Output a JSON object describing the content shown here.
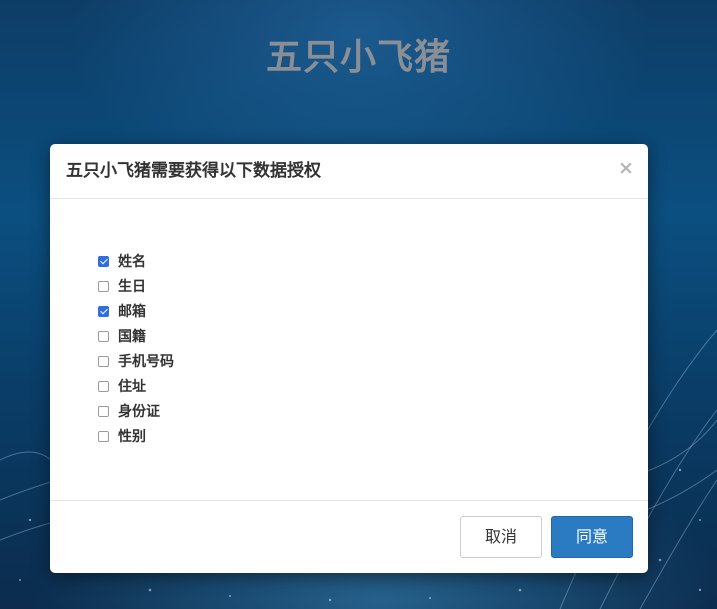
{
  "app": {
    "title": "五只小飞猪"
  },
  "dialog": {
    "title": "五只小飞猪需要获得以下数据授权",
    "close_symbol": "×",
    "permissions": [
      {
        "label": "姓名",
        "checked": true
      },
      {
        "label": "生日",
        "checked": false
      },
      {
        "label": "邮箱",
        "checked": true
      },
      {
        "label": "国籍",
        "checked": false
      },
      {
        "label": "手机号码",
        "checked": false
      },
      {
        "label": "住址",
        "checked": false
      },
      {
        "label": "身份证",
        "checked": false
      },
      {
        "label": "性别",
        "checked": false
      }
    ],
    "cancel_label": "取消",
    "agree_label": "同意"
  },
  "colors": {
    "primary_button": "#2a7bc2",
    "checkbox_checked": "#2f6fe0",
    "title_gray": "#8a8f96"
  },
  "icons": {
    "close": "close-icon",
    "checkbox_checked": "checkbox-checked-icon",
    "checkbox_unchecked": "checkbox-unchecked-icon"
  }
}
